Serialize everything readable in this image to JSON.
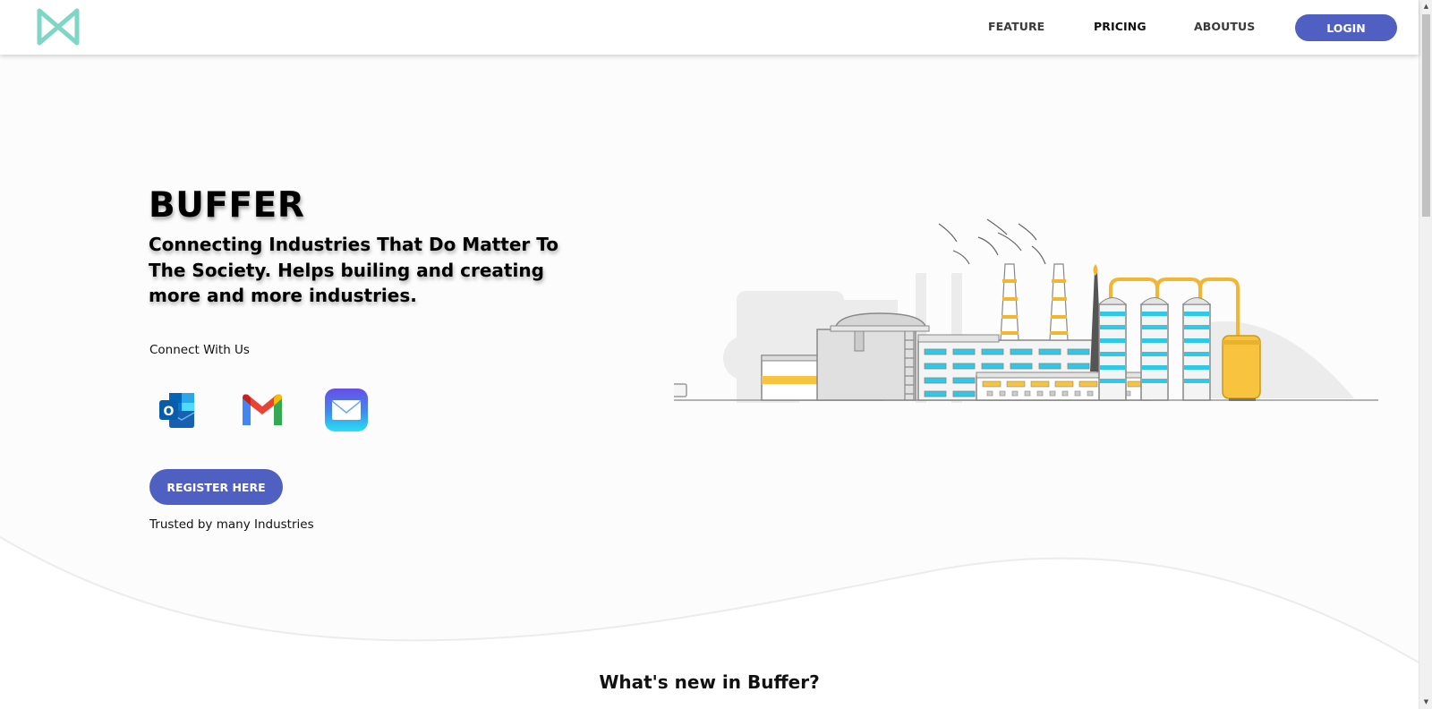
{
  "nav": {
    "logo_icon": "m-bowtie-logo-icon",
    "links": [
      "FEATURE",
      "PRICING",
      "ABOUTUS"
    ],
    "login_label": "LOGIN",
    "accent_color": "#4f5fc2",
    "logo_color": "#7fd6c4"
  },
  "hero": {
    "title": "BUFFER",
    "subtitle": "Connecting Industries That Do Matter To The Society. Helps builing and creating more and more industries.",
    "connect_label": "Connect With Us",
    "connect_icons": [
      "outlook-icon",
      "gmail-icon",
      "mail-app-icon"
    ],
    "register_label": "REGISTER HERE",
    "trusted_text": "Trusted by many Industries",
    "illustration": "factory-illustration"
  },
  "section": {
    "title": "What's new in Buffer?"
  }
}
